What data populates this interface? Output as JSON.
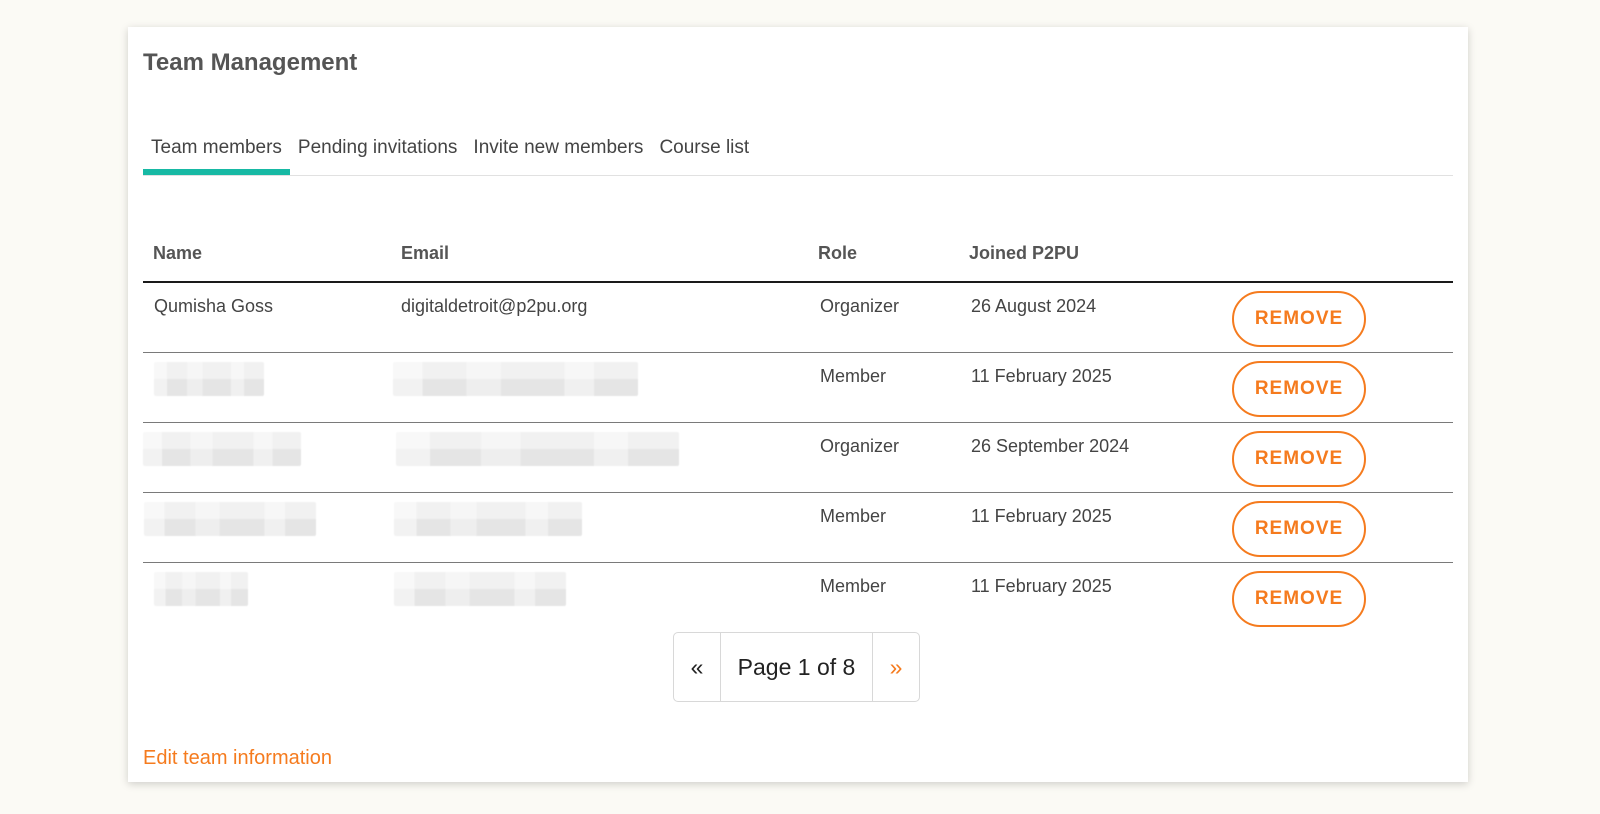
{
  "title": "Team Management",
  "tabs": [
    {
      "label": "Team members",
      "active": true
    },
    {
      "label": "Pending invitations",
      "active": false
    },
    {
      "label": "Invite new members",
      "active": false
    },
    {
      "label": "Course list",
      "active": false
    }
  ],
  "table": {
    "headers": [
      "Name",
      "Email",
      "Role",
      "Joined P2PU",
      ""
    ],
    "rows": [
      {
        "name": "Qumisha Goss",
        "email": "digitaldetroit@p2pu.org",
        "role": "Organizer",
        "joined": "26 August 2024",
        "action": "REMOVE",
        "redacted": false
      },
      {
        "name": "",
        "email": "",
        "role": "Member",
        "joined": "11 February 2025",
        "action": "REMOVE",
        "redacted": true
      },
      {
        "name": "",
        "email": "",
        "role": "Organizer",
        "joined": "26 September 2024",
        "action": "REMOVE",
        "redacted": true
      },
      {
        "name": "",
        "email": "",
        "role": "Member",
        "joined": "11 February 2025",
        "action": "REMOVE",
        "redacted": true
      },
      {
        "name": "",
        "email": "",
        "role": "Member",
        "joined": "11 February 2025",
        "action": "REMOVE",
        "redacted": true
      }
    ]
  },
  "pagination": {
    "prev": "«",
    "label": "Page 1 of 8",
    "next": "»"
  },
  "edit_link": "Edit team information",
  "colors": {
    "accent": "#f57b1e",
    "tab_active": "#17b9a4",
    "background": "#fbfaf5"
  }
}
